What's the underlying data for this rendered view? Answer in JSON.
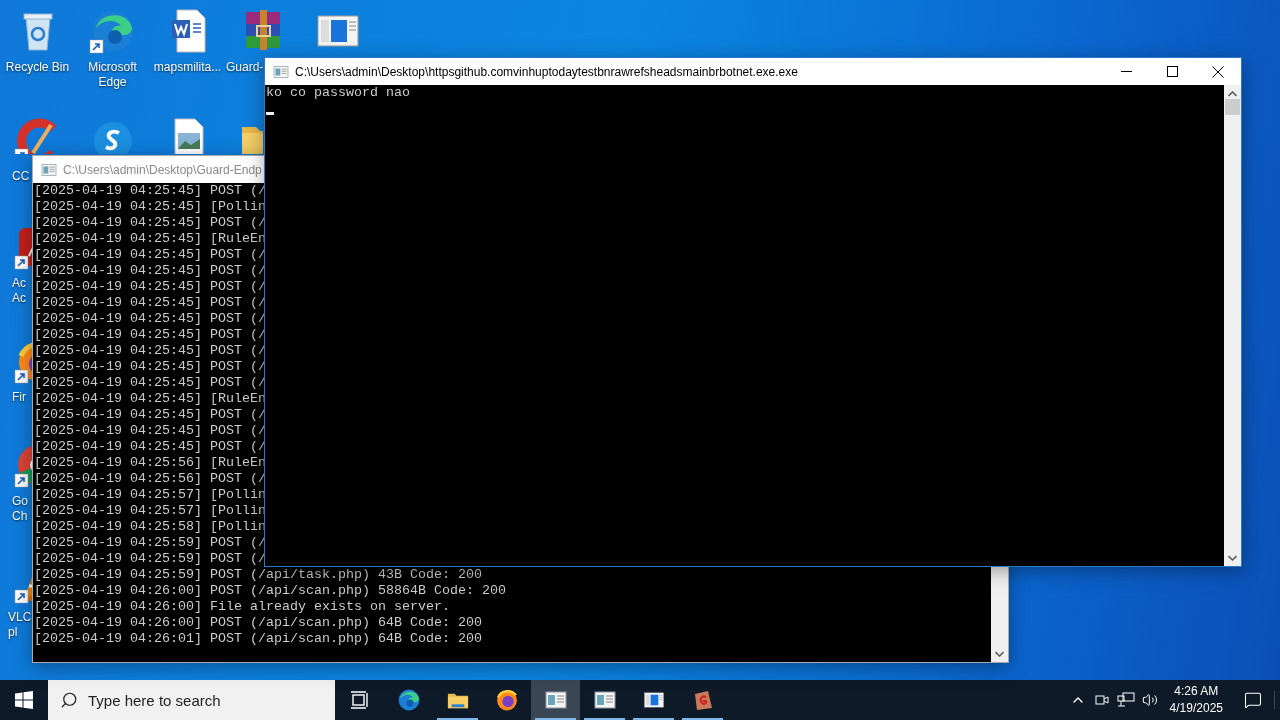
{
  "desktop_icons": [
    {
      "kind": "recycle_bin",
      "label_lines": [
        "Recycle Bin"
      ]
    },
    {
      "kind": "edge",
      "label_lines": [
        "Microsoft",
        "Edge"
      ],
      "shortcut": true
    },
    {
      "kind": "word_doc",
      "label_lines": [
        "mapsmilita..."
      ]
    },
    {
      "kind": "archive",
      "label_lines": [
        "Guard-"
      ]
    },
    {
      "kind": "window_app"
    },
    {
      "kind": "cleaner",
      "label_lines": [
        "CC"
      ],
      "shortcut": true
    },
    {
      "kind": "chat"
    },
    {
      "kind": "image_file"
    },
    {
      "kind": "folder"
    },
    {
      "kind": "pdf_reader",
      "label_lines": [
        "Ac",
        "Ac"
      ],
      "shortcut": true
    },
    {
      "kind": "firefox",
      "label_lines": [
        "Fir"
      ],
      "shortcut": true
    },
    {
      "kind": "chrome",
      "label_lines": [
        "Go",
        "Ch"
      ],
      "shortcut": true
    },
    {
      "kind": "vlc",
      "label_lines": [
        "VLC",
        "pl"
      ],
      "shortcut": true
    }
  ],
  "windows": [
    {
      "title": "C:\\Users\\admin\\Desktop\\Guard-Endp",
      "active": false,
      "cursor": false,
      "lines": [
        "[2025-04-19 04:25:45] POST (/",
        "[2025-04-19 04:25:45] [Pollin",
        "[2025-04-19 04:25:45] POST (/",
        "[2025-04-19 04:25:45] [RuleEn",
        "[2025-04-19 04:25:45] POST (/",
        "[2025-04-19 04:25:45] POST (/",
        "[2025-04-19 04:25:45] POST (/",
        "[2025-04-19 04:25:45] POST (/",
        "[2025-04-19 04:25:45] POST (/",
        "[2025-04-19 04:25:45] POST (/",
        "[2025-04-19 04:25:45] POST (/",
        "[2025-04-19 04:25:45] POST (/",
        "[2025-04-19 04:25:45] POST (/",
        "[2025-04-19 04:25:45] [RuleEn",
        "[2025-04-19 04:25:45] POST (/",
        "[2025-04-19 04:25:45] POST (/",
        "[2025-04-19 04:25:45] POST (/",
        "[2025-04-19 04:25:56] [RuleEn",
        "[2025-04-19 04:25:56] POST (/",
        "[2025-04-19 04:25:57] [Pollin",
        "[2025-04-19 04:25:57] [Pollin",
        "[2025-04-19 04:25:58] [Pollin",
        "[2025-04-19 04:25:59] POST (/",
        "[2025-04-19 04:25:59] POST (/",
        "[2025-04-19 04:25:59] POST (/api/task.php) 43B Code: 200",
        "[2025-04-19 04:26:00] POST (/api/scan.php) 58864B Code: 200",
        "[2025-04-19 04:26:00] File already exists on server.",
        "[2025-04-19 04:26:00] POST (/api/scan.php) 64B Code: 200",
        "[2025-04-19 04:26:01] POST (/api/scan.php) 64B Code: 200"
      ]
    },
    {
      "title": "C:\\Users\\admin\\Desktop\\httpsgithub.comvinhuptodaytestbnrawrefsheadsmainbrbotnet.exe.exe",
      "active": true,
      "cursor": true,
      "lines": [
        "ko co password nao"
      ]
    }
  ],
  "taskbar": {
    "search": {
      "placeholder": "Type here to search"
    },
    "apps": [
      {
        "kind": "task_view",
        "running": false,
        "selected": false
      },
      {
        "kind": "edge",
        "running": false,
        "selected": false
      },
      {
        "kind": "explorer",
        "running": true,
        "selected": false
      },
      {
        "kind": "firefox",
        "running": false,
        "selected": false
      },
      {
        "kind": "console",
        "running": true,
        "selected": true
      },
      {
        "kind": "console",
        "running": true,
        "selected": false
      },
      {
        "kind": "window_app",
        "running": true,
        "selected": false
      },
      {
        "kind": "red_app",
        "running": true,
        "selected": false
      }
    ],
    "tray": {
      "time": "4:26 AM",
      "date": "4/19/2025"
    }
  }
}
